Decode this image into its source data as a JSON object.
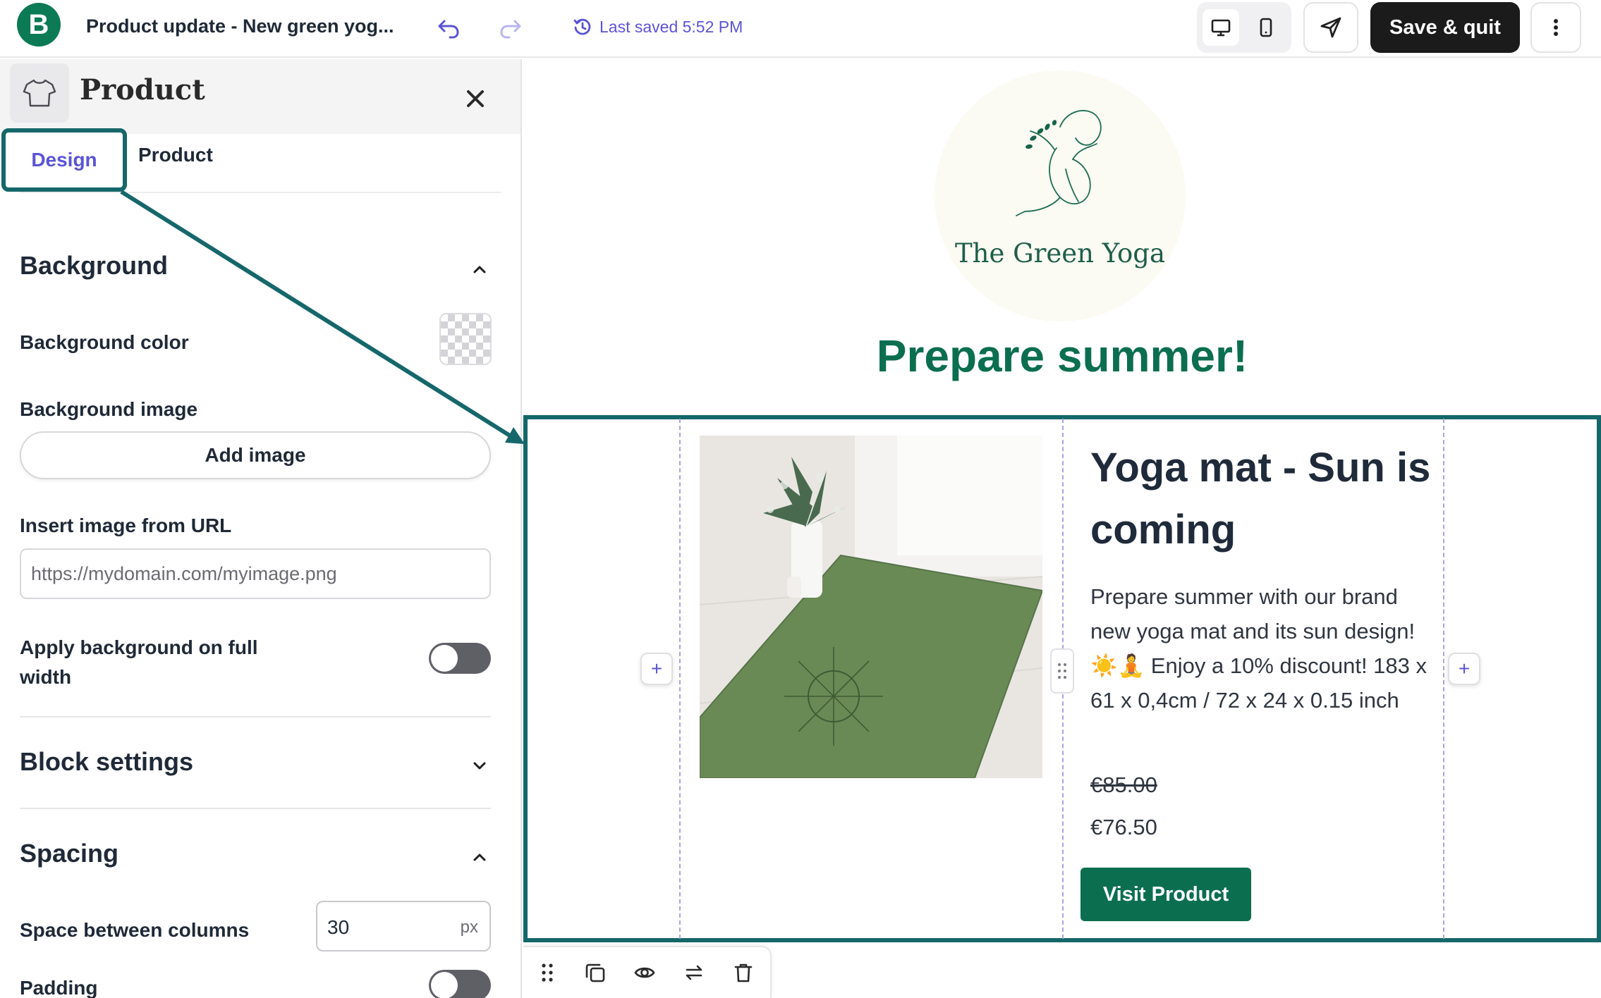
{
  "header": {
    "brand_letter": "B",
    "document_title": "Product update - New green yog...",
    "last_saved": "Last saved 5:52 PM",
    "save_quit_label": "Save & quit"
  },
  "panel": {
    "title": "Product",
    "tabs": [
      "Design",
      "Product"
    ],
    "background": {
      "section_title": "Background",
      "color_label": "Background color",
      "image_label": "Background image",
      "add_image_label": "Add image",
      "url_label": "Insert image from URL",
      "url_placeholder": "https://mydomain.com/myimage.png",
      "full_width_label": "Apply background on full width",
      "full_width_on": false
    },
    "block_settings_title": "Block settings",
    "spacing": {
      "section_title": "Spacing",
      "columns_label": "Space between columns",
      "columns_value": "30",
      "columns_unit": "px",
      "padding_label": "Padding",
      "padding_on": false
    }
  },
  "canvas": {
    "brand_name": "The Green Yoga",
    "headline": "Prepare summer!",
    "product": {
      "title": "Yoga mat - Sun is coming",
      "description": "Prepare summer with our brand new yoga mat and its sun design! ☀️🧘 Enjoy a 10% discount! 183 x 61 x 0,4cm / 72 x 24 x 0.15 inch",
      "old_price": "€85.00",
      "new_price": "€76.50",
      "cta_label": "Visit Product"
    },
    "add_column_symbol": "+"
  },
  "colors": {
    "brand_green": "#0b6e4f",
    "accent_purple": "#5b54d6",
    "selection_teal": "#15676a",
    "save_button_bg": "#1b1b1b"
  },
  "icons": [
    "undo-icon",
    "redo-icon",
    "history-icon",
    "desktop-icon",
    "mobile-icon",
    "send-icon",
    "more-vertical-icon",
    "shirt-icon",
    "close-icon",
    "chevron-up-icon",
    "chevron-down-icon",
    "drag-icon",
    "duplicate-icon",
    "eye-icon",
    "swap-icon",
    "trash-icon"
  ]
}
